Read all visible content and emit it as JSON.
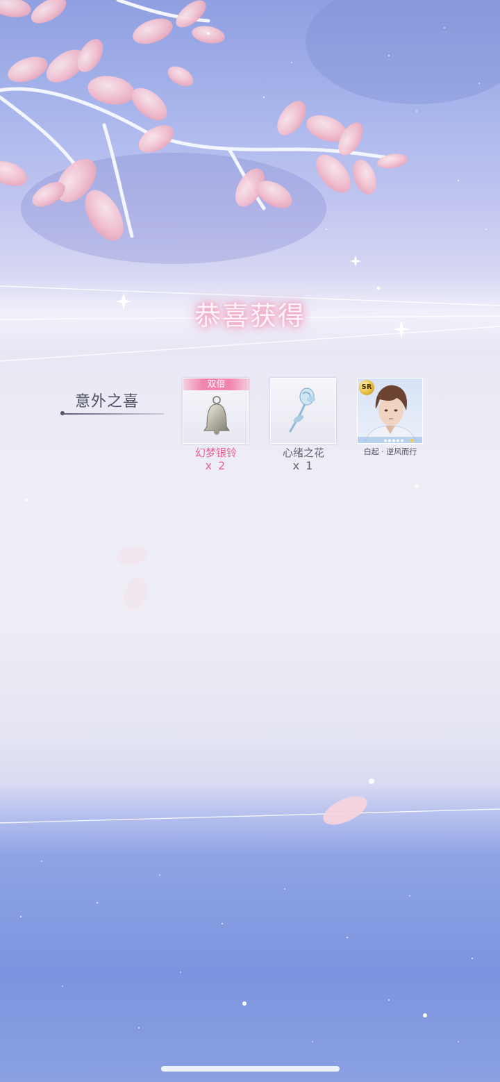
{
  "header": {
    "title": "恭喜获得"
  },
  "section": {
    "label": "意外之喜"
  },
  "rewards": [
    {
      "badge": "双倍",
      "name": "幻梦银铃",
      "quantity": "x 2",
      "icon": "silver-bell-icon"
    },
    {
      "name": "心绪之花",
      "quantity": "x 1",
      "icon": "blue-rose-icon"
    },
    {
      "rarity": "SR",
      "caption": "白起 · 逆风而行",
      "icon": "character-portrait"
    }
  ],
  "colors": {
    "title_glow": "#ee8fb6",
    "highlight_text": "#e8608e",
    "normal_text": "#606274",
    "badge_bg": "#f085ad"
  }
}
